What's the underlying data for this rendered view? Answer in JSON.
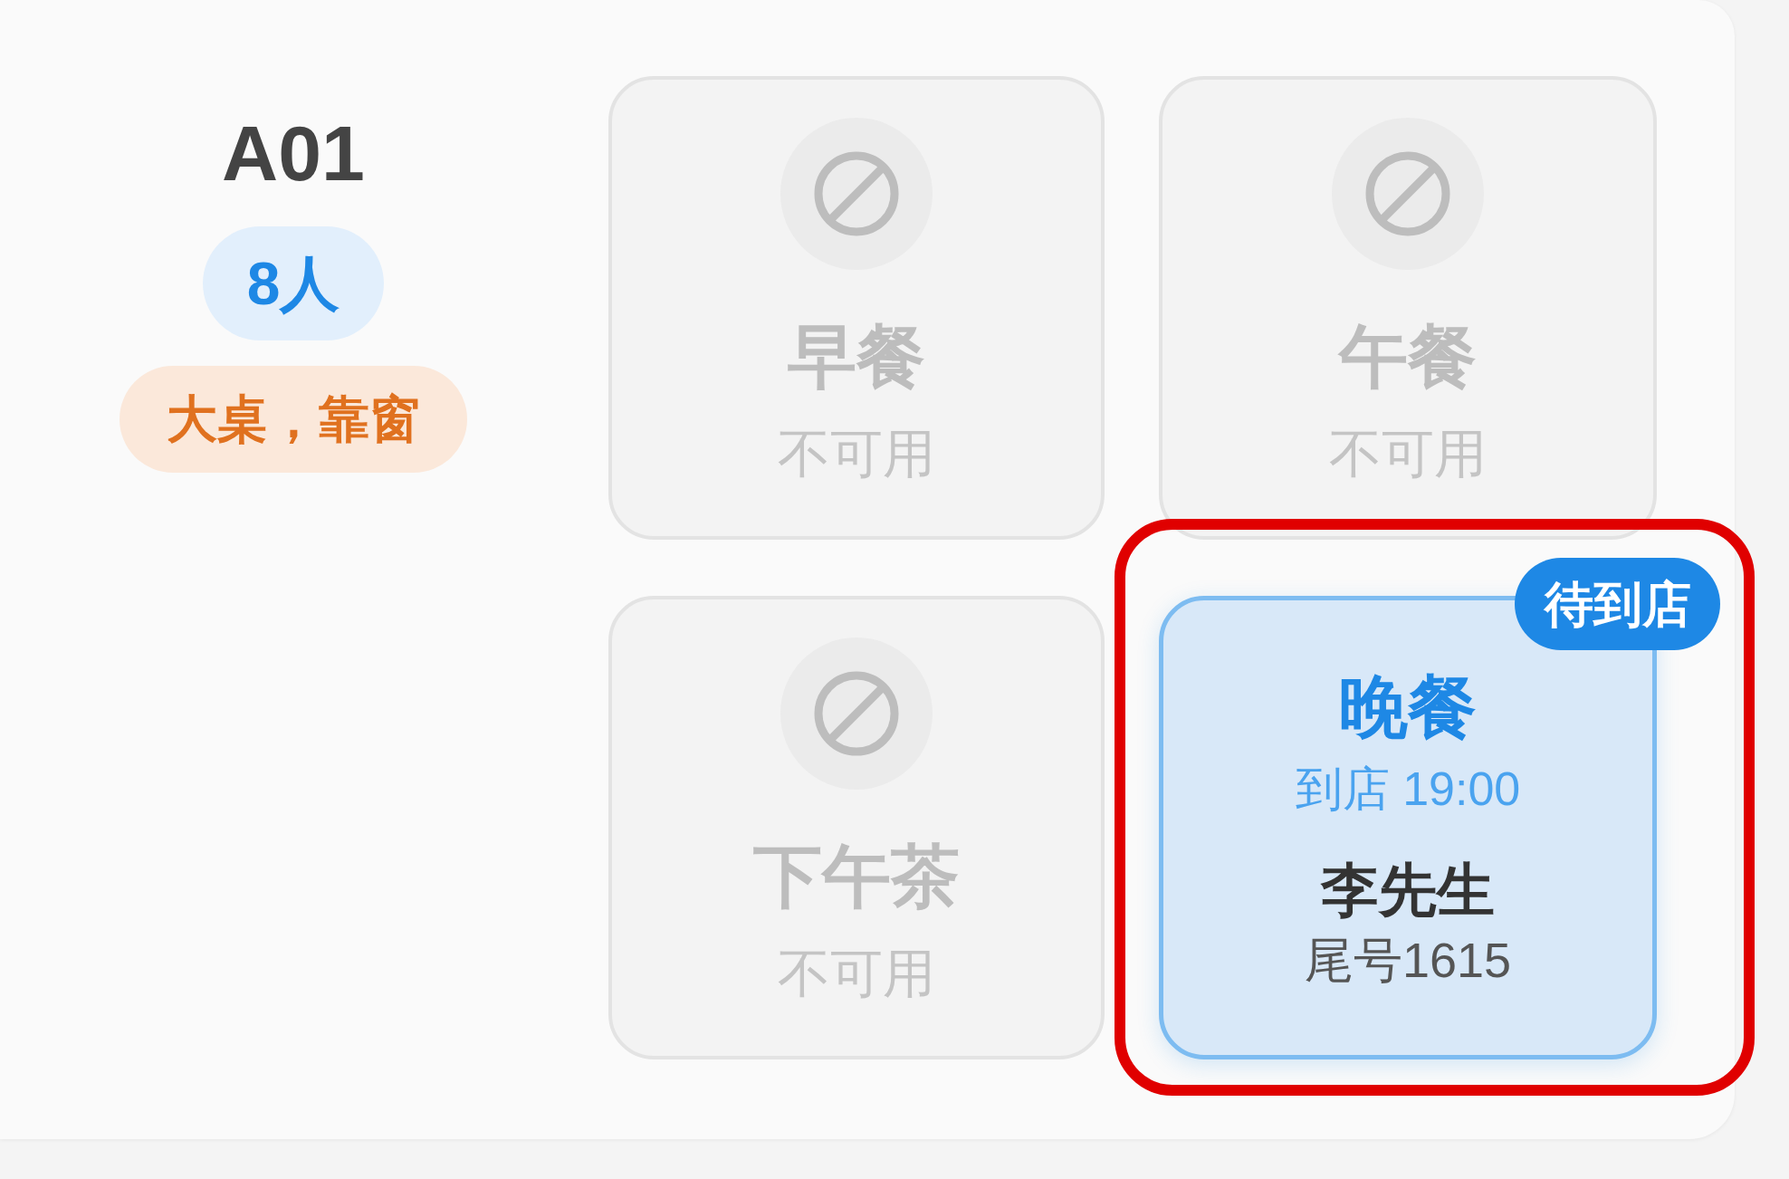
{
  "table": {
    "name": "A01",
    "capacity": "8人",
    "tags": [
      "大桌，靠窗"
    ]
  },
  "slots": [
    {
      "meal": "早餐",
      "kind": "unavailable",
      "status": "不可用",
      "highlighted": false
    },
    {
      "meal": "午餐",
      "kind": "unavailable",
      "status": "不可用",
      "highlighted": false
    },
    {
      "meal": "下午茶",
      "kind": "unavailable",
      "status": "不可用",
      "highlighted": false
    },
    {
      "meal": "晚餐",
      "kind": "booked",
      "badge": "待到店",
      "arrival": "到店 19:00",
      "guest": "李先生",
      "phone_tail": "尾号1615",
      "highlighted": true
    }
  ]
}
